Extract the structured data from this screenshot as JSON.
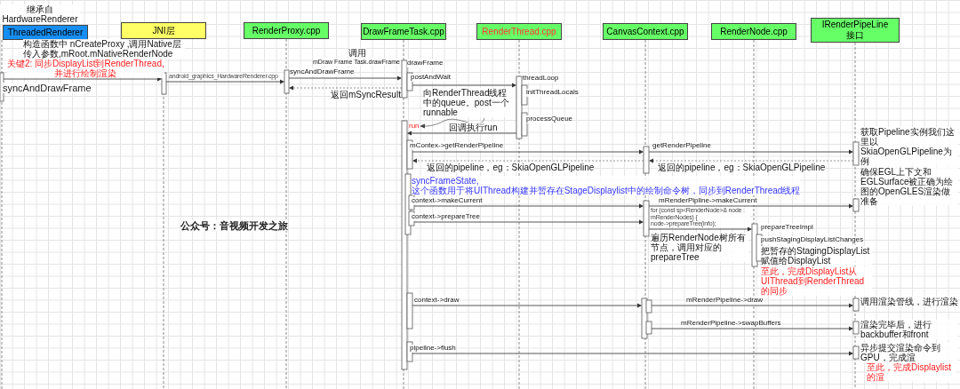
{
  "lifelines": [
    {
      "label": "ThreadedRenderer",
      "color": "#168ef5",
      "highlighted": false
    },
    {
      "label": "JNI层",
      "color": "#ffff66",
      "highlighted": false
    },
    {
      "label": "RenderProxy.cpp",
      "color": "#66ff66",
      "highlighted": false
    },
    {
      "label": "DrawFrameTask.cpp",
      "color": "#66ff66",
      "highlighted": false
    },
    {
      "label": "RenderThread.cpp",
      "color": "#66ff66",
      "highlighted": true
    },
    {
      "label": "CanvasContext.cpp",
      "color": "#66ff66",
      "highlighted": false
    },
    {
      "label": "RenderNode.cpp",
      "color": "#66ff66",
      "highlighted": false
    },
    {
      "label": "IRenderPipeLine\n接口",
      "color": "#66ff66",
      "highlighted": false
    }
  ],
  "texts": [
    {
      "text": "继承自\nHardwareRenderer",
      "kind": "note"
    },
    {
      "text": "构造函数中 nCreateProxy ,调用Native层传入参数,mRoot.mNativeRenderNode",
      "kind": "note"
    },
    {
      "text": "关键2: 同步DisplayList到RenderThread,\n并进行绘制渲染",
      "kind": "warning"
    },
    {
      "text": "syncAndDrawFrame",
      "kind": "caption"
    },
    {
      "text": "android_graphics_HardwareRenderer.cpp",
      "kind": "code"
    },
    {
      "text": "syncAndDrawFrame",
      "kind": "label"
    },
    {
      "text": "调用",
      "kind": "note"
    },
    {
      "text": "mDraw Frame Task.drawFrame",
      "kind": "label"
    },
    {
      "text": "返回mSyncResult",
      "kind": "note"
    },
    {
      "text": "drawFrame",
      "kind": "label"
    },
    {
      "text": "postAndWait",
      "kind": "label"
    },
    {
      "text": "向RenderThread线程中的queue。post一个runnable",
      "kind": "note"
    },
    {
      "text": "threadLoop",
      "kind": "label"
    },
    {
      "text": "initThreadLocals",
      "kind": "label"
    },
    {
      "text": "processQueue",
      "kind": "label"
    },
    {
      "text": "run",
      "kind": "warning"
    },
    {
      "text": "回调执行run",
      "kind": "note"
    },
    {
      "text": "mContex->getRenderPipeline",
      "kind": "label"
    },
    {
      "text": "返回的pipeline，eg：SkiaOpenGLPipeline",
      "kind": "note"
    },
    {
      "text": "getRenderPipeline",
      "kind": "label"
    },
    {
      "text": "返回的pipeline，eg：SkiaOpenGLPipeline",
      "kind": "note"
    },
    {
      "text": "获取Pipeline实例我们这里以SkiaOpenGLPipeline为例",
      "kind": "note"
    },
    {
      "text": "syncFrameState,\n这个函数用于将UIThread构建并暂存在StageDisplaylist中的绘制命令树，同步到RenderThread线程",
      "kind": "info"
    },
    {
      "text": "context->makeCurrent",
      "kind": "label"
    },
    {
      "text": "mRenderPipline->makeCurrent",
      "kind": "label"
    },
    {
      "text": "确保EGL上下文和EGLSurface被正确为绘图的OpenGLES渲染做准备",
      "kind": "note"
    },
    {
      "text": "context->prepareTree",
      "kind": "label"
    },
    {
      "text": "for (const sp<RenderNode>& node : mRenderNodes) {\nnode->prepareTree(info);",
      "kind": "code"
    },
    {
      "text": "prepareTreeImpl",
      "kind": "label"
    },
    {
      "text": "遍历RenderNode树所有节点，调用对应的prepareTree",
      "kind": "note"
    },
    {
      "text": "pushStagingDisplayListChanges",
      "kind": "label"
    },
    {
      "text": "把暂存的StagingDisplayList赋值给DisplayList",
      "kind": "note"
    },
    {
      "text": "至此，完成DisplayList从UIThread到RenderThread的同步",
      "kind": "warning"
    },
    {
      "text": "公众号：音视频开发之旅",
      "kind": "heading"
    },
    {
      "text": "context->draw",
      "kind": "label"
    },
    {
      "text": "mRenderPipeline->draw",
      "kind": "label"
    },
    {
      "text": "调用渲染管线，进行渲染",
      "kind": "note"
    },
    {
      "text": "mRenderPipeline->swapBuffers",
      "kind": "label"
    },
    {
      "text": "渲染完毕后，进行backbuffer和front",
      "kind": "note"
    },
    {
      "text": "pipeline->flush",
      "kind": "label"
    },
    {
      "text": "异步提交渲染命令到GPU，完成渲",
      "kind": "note"
    },
    {
      "text": "至此，完成Displaylist的渲",
      "kind": "warning"
    }
  ],
  "arrows": [
    {
      "kind": "call"
    },
    {
      "kind": "call"
    },
    {
      "kind": "call"
    },
    {
      "kind": "return"
    },
    {
      "kind": "call"
    },
    {
      "kind": "call"
    },
    {
      "kind": "call"
    },
    {
      "kind": "call"
    },
    {
      "kind": "return"
    },
    {
      "kind": "return"
    },
    {
      "kind": "call"
    },
    {
      "kind": "call"
    },
    {
      "kind": "call"
    },
    {
      "kind": "call"
    },
    {
      "kind": "call"
    },
    {
      "kind": "call"
    },
    {
      "kind": "call"
    },
    {
      "kind": "call"
    }
  ]
}
